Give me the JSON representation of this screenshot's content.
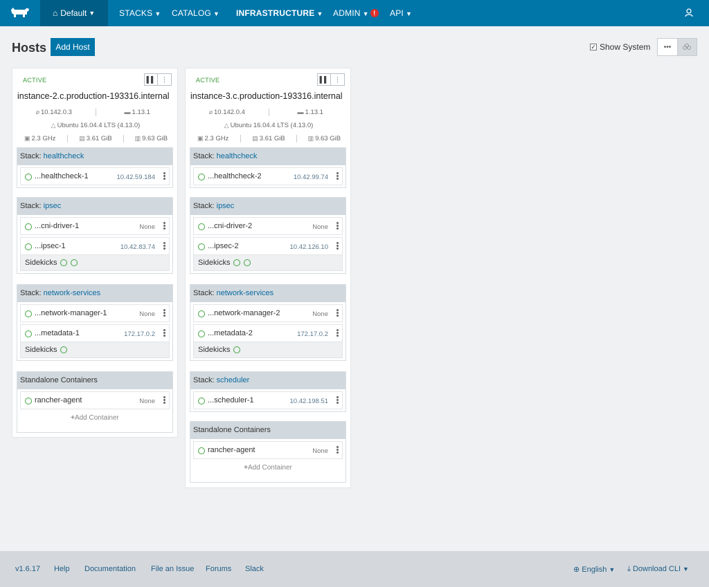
{
  "nav": {
    "environment": "Default",
    "items": [
      {
        "label": "STACKS"
      },
      {
        "label": "CATALOG"
      },
      {
        "label": "INFRASTRUCTURE"
      },
      {
        "label": "ADMIN"
      },
      {
        "label": "API"
      }
    ],
    "admin_alert": "!"
  },
  "page": {
    "title": "Hosts",
    "add_host_label": "Add Host",
    "show_system_label": "Show System",
    "show_system_checked": true
  },
  "hosts": [
    {
      "state": "ACTIVE",
      "name": "instance-2.c.production-193316.internal",
      "ip": "10.142.0.3",
      "docker": "1.13.1",
      "os": "Ubuntu 16.04.4 LTS (4.13.0)",
      "cpu": "2.3 GHz",
      "memory": "3.61 GiB",
      "storage": "9.63 GiB",
      "stacks": [
        {
          "prefix": "Stack: ",
          "name": "healthcheck",
          "containers": [
            {
              "name": "...healthcheck-1",
              "ip": "10.42.59.184"
            }
          ]
        },
        {
          "prefix": "Stack: ",
          "name": "ipsec",
          "containers": [
            {
              "name": "...cni-driver-1",
              "ip": "None"
            },
            {
              "name": "...ipsec-1",
              "ip": "10.42.83.74"
            }
          ],
          "sidekicks": "Sidekicks"
        },
        {
          "prefix": "Stack: ",
          "name": "network-services",
          "containers": [
            {
              "name": "...network-manager-1",
              "ip": "None"
            },
            {
              "name": "...metadata-1",
              "ip": "172.17.0.2"
            }
          ],
          "sidekicks": "Sidekicks"
        }
      ],
      "standalone": {
        "title": "Standalone Containers",
        "containers": [
          {
            "name": "rancher-agent",
            "ip": "None"
          }
        ],
        "add_label": "Add Container"
      }
    },
    {
      "state": "ACTIVE",
      "name": "instance-3.c.production-193316.internal",
      "ip": "10.142.0.4",
      "docker": "1.13.1",
      "os": "Ubuntu 16.04.4 LTS (4.13.0)",
      "cpu": "2.3 GHz",
      "memory": "3.61 GiB",
      "storage": "9.63 GiB",
      "stacks": [
        {
          "prefix": "Stack: ",
          "name": "healthcheck",
          "containers": [
            {
              "name": "...healthcheck-2",
              "ip": "10.42.99.74"
            }
          ]
        },
        {
          "prefix": "Stack: ",
          "name": "ipsec",
          "containers": [
            {
              "name": "...cni-driver-2",
              "ip": "None"
            },
            {
              "name": "...ipsec-2",
              "ip": "10.42.126.10"
            }
          ],
          "sidekicks": "Sidekicks"
        },
        {
          "prefix": "Stack: ",
          "name": "network-services",
          "containers": [
            {
              "name": "...network-manager-2",
              "ip": "None"
            },
            {
              "name": "...metadata-2",
              "ip": "172.17.0.2"
            }
          ],
          "sidekicks": "Sidekicks"
        },
        {
          "prefix": "Stack: ",
          "name": "scheduler",
          "containers": [
            {
              "name": "...scheduler-1",
              "ip": "10.42.198.51"
            }
          ]
        }
      ],
      "standalone": {
        "title": "Standalone Containers",
        "containers": [
          {
            "name": "rancher-agent",
            "ip": "None"
          }
        ],
        "add_label": "Add Container"
      }
    }
  ],
  "footer": {
    "version": "v1.6.17",
    "links": [
      "Help",
      "Documentation",
      "File an Issue",
      "Forums",
      "Slack"
    ],
    "language": "English",
    "download": "Download CLI"
  }
}
